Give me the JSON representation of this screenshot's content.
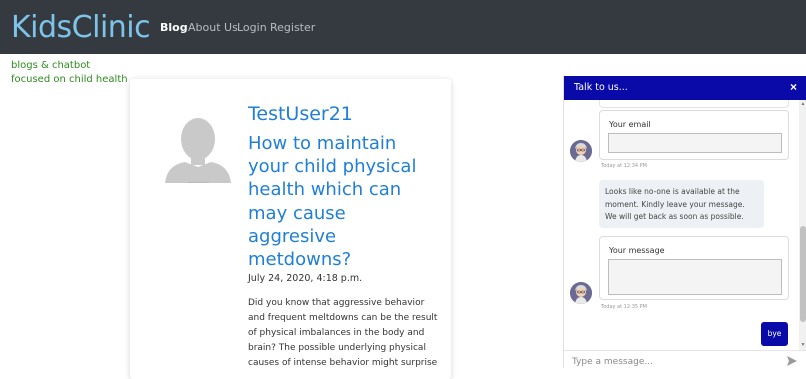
{
  "navbar": {
    "brand": "KidsClinic",
    "links": [
      {
        "label": "Blog",
        "active": true
      },
      {
        "label": "About Us",
        "active": false
      },
      {
        "label": "Login",
        "active": false
      },
      {
        "label": "Register",
        "active": false
      }
    ]
  },
  "tagline": {
    "line1": "blogs & chatbot",
    "line2": "focused on child health"
  },
  "post": {
    "author": "TestUser21",
    "title": "How to maintain your child physical health which can may cause aggresive metdowns?",
    "date": "July 24, 2020, 4:18 p.m.",
    "body": "Did you know that aggressive behavior and frequent meltdowns can be the result of physical imbalances in the body and brain? The possible underlying physical causes of intense behavior might surprise"
  },
  "chat": {
    "title": "Talk to us...",
    "close": "×",
    "email_label": "Your email",
    "email_timestamp": "Today at 12:34 PM",
    "bot_message": "Looks like no-one is available at the moment. Kindly leave your message. We will get back as soon as possible.",
    "message_label": "Your message",
    "message_timestamp": "Today at 12:35 PM",
    "bye_label": "bye",
    "input_placeholder": "Type a message..."
  },
  "colors": {
    "navbar_bg": "#343a40",
    "brand": "#7ec4ea",
    "link_blue": "#1f7fd6",
    "tagline_green": "#2e8b1f",
    "chat_header": "#0a0aa8"
  },
  "icons": {
    "avatar": "user-silhouette-icon",
    "bot": "bot-avatar-icon",
    "send": "send-arrow-icon",
    "close": "close-icon"
  }
}
